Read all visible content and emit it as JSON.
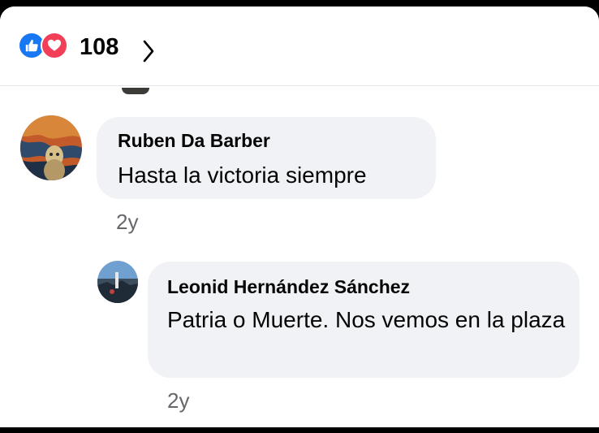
{
  "reactions": {
    "count": "108",
    "icons": [
      "like-icon",
      "love-icon",
      "chevron-right-icon"
    ],
    "like_color": "#1877f2",
    "love_color": "#f33e58"
  },
  "comments": [
    {
      "author": "Ruben Da Barber",
      "text": "Hasta la victoria siempre",
      "time": "2y"
    },
    {
      "author": "Leonid Hernández Sánchez",
      "text": "Patria o Muerte. Nos vemos en la plaza",
      "time": "2y"
    }
  ],
  "colors": {
    "bubble": "#f0f2f5",
    "timestamp": "#65676b"
  }
}
